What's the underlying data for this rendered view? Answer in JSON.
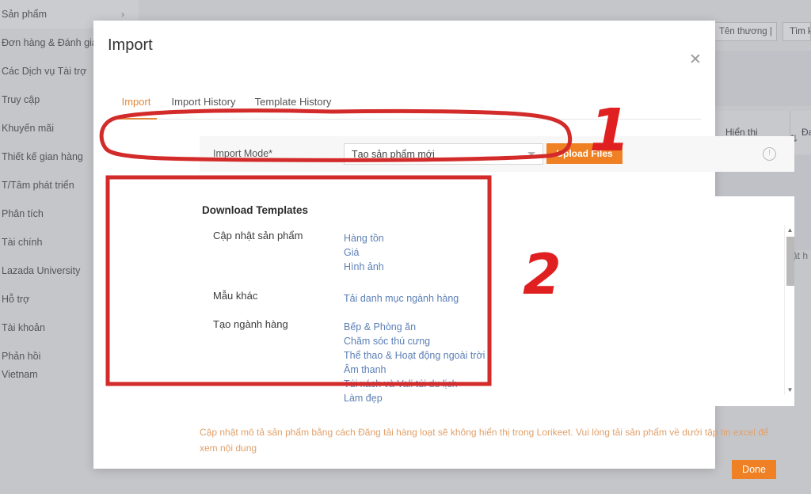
{
  "sidebar": {
    "items": [
      {
        "label": "Sản phẩm",
        "chevron": "›",
        "active": true
      },
      {
        "label": "Đơn hàng & Đánh giá",
        "chevron": "",
        "active": false
      },
      {
        "label": "Các Dịch vụ Tài trợ",
        "chevron": "",
        "active": false
      },
      {
        "label": "Truy cập",
        "chevron": "",
        "active": false
      },
      {
        "label": "Khuyến mãi",
        "chevron": "",
        "active": false
      },
      {
        "label": "Thiết kế gian hàng",
        "chevron": "",
        "active": false
      },
      {
        "label": "T/Tâm phát triển",
        "chevron": "",
        "active": false
      },
      {
        "label": "Phân tích",
        "chevron": "",
        "active": false
      },
      {
        "label": "Tài chính",
        "chevron": "",
        "active": false
      },
      {
        "label": "Lazada University",
        "chevron": "",
        "active": false
      },
      {
        "label": "Hỗ trợ",
        "chevron": "",
        "active": false
      },
      {
        "label": "Tài khoản",
        "chevron": "",
        "active": false
      },
      {
        "label": "Phản hồi",
        "chevron": "",
        "active": false
      }
    ],
    "country": "Vietnam"
  },
  "background": {
    "brand_filter_value": "Tên thương |",
    "search_button": "Tìm k",
    "column_display": "Hiển thị",
    "column_status": "Đang",
    "sort_icon": "⇅",
    "partial_text": "mặt h"
  },
  "modal": {
    "title": "Import",
    "close_icon": "✕",
    "tabs": [
      {
        "label": "Import",
        "active": true
      },
      {
        "label": "Import History",
        "active": false
      },
      {
        "label": "Template History",
        "active": false
      }
    ],
    "import_mode": {
      "label": "Import Mode*",
      "selected": "Tạo sản phẩm mới",
      "placeholder": "Tạo sản phẩm mới",
      "upload_button": "Upload Files",
      "info_icon": "!"
    },
    "download_templates": {
      "title": "Download Templates",
      "groups": [
        {
          "name": "Cập nhật sản phẩm",
          "links": [
            "Hàng tồn",
            "Giá",
            "Hình ảnh"
          ]
        },
        {
          "name": "Mẫu khác",
          "links": [
            "Tải danh mục ngành hàng"
          ]
        },
        {
          "name": "Tạo ngành hàng",
          "links": [
            "Bếp & Phòng ăn",
            "Chăm sóc thú cưng",
            "Thể thao & Hoạt động ngoài trời",
            "Âm thanh",
            "Túi xách và Vali túi du lịch",
            "Làm đẹp"
          ]
        }
      ],
      "scroll_up_icon": "▲",
      "scroll_down_icon": "▼"
    },
    "note": "Cập nhật mô tả sản phẩm bằng cách Đăng tải hàng loạt sẽ không hiển thị trong Lorikeet. Vui lòng tải sản phẩm về dưới tập tin excel để xem nội dung",
    "done_button": "Done"
  },
  "annotations": {
    "number_one": "1",
    "number_two": "2",
    "accent_red": "#e02020",
    "accent_orange": "#ef8023",
    "link_blue": "#5b7fb5"
  }
}
